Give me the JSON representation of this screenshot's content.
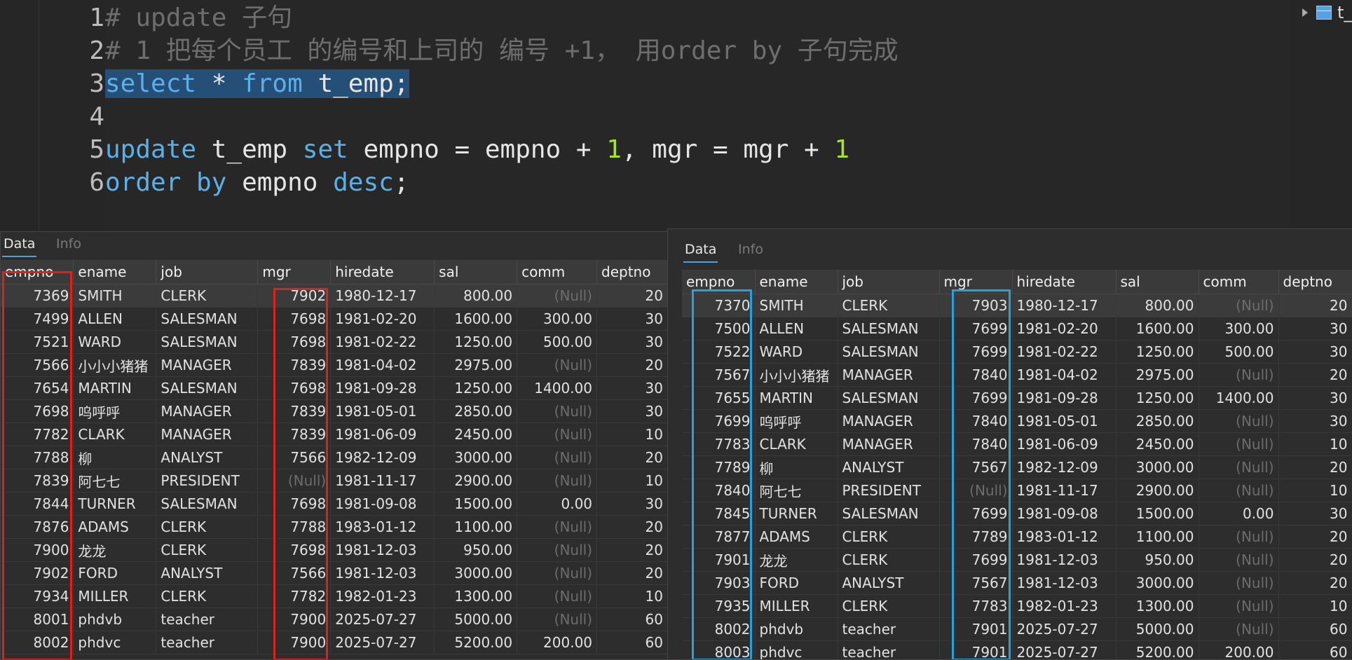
{
  "editor": {
    "lines": [
      {
        "n": "1",
        "parts": [
          {
            "t": "# update 子句",
            "c": "comment"
          }
        ]
      },
      {
        "n": "2",
        "parts": [
          {
            "t": "# 1 把每个员工 的编号和上司的 编号 +1， 用order by 子句完成",
            "c": "comment"
          }
        ]
      },
      {
        "n": "3",
        "parts": [
          {
            "t": "select",
            "c": "kw"
          },
          {
            "t": " * ",
            "c": "plain"
          },
          {
            "t": "from",
            "c": "kw"
          },
          {
            "t": " t_emp;",
            "c": "plain"
          }
        ],
        "selected": true
      },
      {
        "n": "4",
        "parts": []
      },
      {
        "n": "5",
        "parts": [
          {
            "t": "update",
            "c": "kw"
          },
          {
            "t": " t_emp ",
            "c": "plain"
          },
          {
            "t": "set",
            "c": "kw"
          },
          {
            "t": " empno = empno + ",
            "c": "plain"
          },
          {
            "t": "1",
            "c": "num"
          },
          {
            "t": ", mgr = mgr + ",
            "c": "plain"
          },
          {
            "t": "1",
            "c": "num"
          }
        ]
      },
      {
        "n": "6",
        "parts": [
          {
            "t": "order by",
            "c": "kw"
          },
          {
            "t": " empno ",
            "c": "plain"
          },
          {
            "t": "desc",
            "c": "kw"
          },
          {
            "t": ";",
            "c": "plain"
          }
        ]
      }
    ],
    "tree_label": "t_"
  },
  "left_panel": {
    "tabs": [
      "Data",
      "Info"
    ],
    "columns": [
      "empno",
      "ename",
      "job",
      "mgr",
      "hiredate",
      "sal",
      "comm",
      "deptno"
    ],
    "rows": [
      [
        "7369",
        "SMITH",
        "CLERK",
        "7902",
        "1980-12-17",
        "800.00",
        "(Null)",
        "20"
      ],
      [
        "7499",
        "ALLEN",
        "SALESMAN",
        "7698",
        "1981-02-20",
        "1600.00",
        "300.00",
        "30"
      ],
      [
        "7521",
        "WARD",
        "SALESMAN",
        "7698",
        "1981-02-22",
        "1250.00",
        "500.00",
        "30"
      ],
      [
        "7566",
        "小小小猪猪",
        "MANAGER",
        "7839",
        "1981-04-02",
        "2975.00",
        "(Null)",
        "20"
      ],
      [
        "7654",
        "MARTIN",
        "SALESMAN",
        "7698",
        "1981-09-28",
        "1250.00",
        "1400.00",
        "30"
      ],
      [
        "7698",
        "呜呼呼",
        "MANAGER",
        "7839",
        "1981-05-01",
        "2850.00",
        "(Null)",
        "30"
      ],
      [
        "7782",
        "CLARK",
        "MANAGER",
        "7839",
        "1981-06-09",
        "2450.00",
        "(Null)",
        "10"
      ],
      [
        "7788",
        "柳",
        "ANALYST",
        "7566",
        "1982-12-09",
        "3000.00",
        "(Null)",
        "20"
      ],
      [
        "7839",
        "阿七七",
        "PRESIDENT",
        "(Null)",
        "1981-11-17",
        "2900.00",
        "(Null)",
        "10"
      ],
      [
        "7844",
        "TURNER",
        "SALESMAN",
        "7698",
        "1981-09-08",
        "1500.00",
        "0.00",
        "30"
      ],
      [
        "7876",
        "ADAMS",
        "CLERK",
        "7788",
        "1983-01-12",
        "1100.00",
        "(Null)",
        "20"
      ],
      [
        "7900",
        "龙龙",
        "CLERK",
        "7698",
        "1981-12-03",
        "950.00",
        "(Null)",
        "20"
      ],
      [
        "7902",
        "FORD",
        "ANALYST",
        "7566",
        "1981-12-03",
        "3000.00",
        "(Null)",
        "20"
      ],
      [
        "7934",
        "MILLER",
        "CLERK",
        "7782",
        "1982-01-23",
        "1300.00",
        "(Null)",
        "10"
      ],
      [
        "8001",
        "phdvb",
        "teacher",
        "7900",
        "2025-07-27",
        "5000.00",
        "(Null)",
        "60"
      ],
      [
        "8002",
        "phdvc",
        "teacher",
        "7900",
        "2025-07-27",
        "5200.00",
        "200.00",
        "60"
      ]
    ]
  },
  "right_panel": {
    "tabs": [
      "Data",
      "Info"
    ],
    "columns": [
      "empno",
      "ename",
      "job",
      "mgr",
      "hiredate",
      "sal",
      "comm",
      "deptno"
    ],
    "rows": [
      [
        "7370",
        "SMITH",
        "CLERK",
        "7903",
        "1980-12-17",
        "800.00",
        "(Null)",
        "20"
      ],
      [
        "7500",
        "ALLEN",
        "SALESMAN",
        "7699",
        "1981-02-20",
        "1600.00",
        "300.00",
        "30"
      ],
      [
        "7522",
        "WARD",
        "SALESMAN",
        "7699",
        "1981-02-22",
        "1250.00",
        "500.00",
        "30"
      ],
      [
        "7567",
        "小小小猪猪",
        "MANAGER",
        "7840",
        "1981-04-02",
        "2975.00",
        "(Null)",
        "20"
      ],
      [
        "7655",
        "MARTIN",
        "SALESMAN",
        "7699",
        "1981-09-28",
        "1250.00",
        "1400.00",
        "30"
      ],
      [
        "7699",
        "呜呼呼",
        "MANAGER",
        "7840",
        "1981-05-01",
        "2850.00",
        "(Null)",
        "30"
      ],
      [
        "7783",
        "CLARK",
        "MANAGER",
        "7840",
        "1981-06-09",
        "2450.00",
        "(Null)",
        "10"
      ],
      [
        "7789",
        "柳",
        "ANALYST",
        "7567",
        "1982-12-09",
        "3000.00",
        "(Null)",
        "20"
      ],
      [
        "7840",
        "阿七七",
        "PRESIDENT",
        "(Null)",
        "1981-11-17",
        "2900.00",
        "(Null)",
        "10"
      ],
      [
        "7845",
        "TURNER",
        "SALESMAN",
        "7699",
        "1981-09-08",
        "1500.00",
        "0.00",
        "30"
      ],
      [
        "7877",
        "ADAMS",
        "CLERK",
        "7789",
        "1983-01-12",
        "1100.00",
        "(Null)",
        "20"
      ],
      [
        "7901",
        "龙龙",
        "CLERK",
        "7699",
        "1981-12-03",
        "950.00",
        "(Null)",
        "20"
      ],
      [
        "7903",
        "FORD",
        "ANALYST",
        "7567",
        "1981-12-03",
        "3000.00",
        "(Null)",
        "20"
      ],
      [
        "7935",
        "MILLER",
        "CLERK",
        "7783",
        "1982-01-23",
        "1300.00",
        "(Null)",
        "10"
      ],
      [
        "8002",
        "phdvb",
        "teacher",
        "7901",
        "2025-07-27",
        "5000.00",
        "(Null)",
        "60"
      ],
      [
        "8003",
        "phdvc",
        "teacher",
        "7901",
        "2025-07-27",
        "5200.00",
        "200.00",
        "60"
      ]
    ]
  },
  "colors": {
    "left_highlight": "#e0201b",
    "right_highlight": "#2a9fd8",
    "accent": "#4aa3df"
  }
}
